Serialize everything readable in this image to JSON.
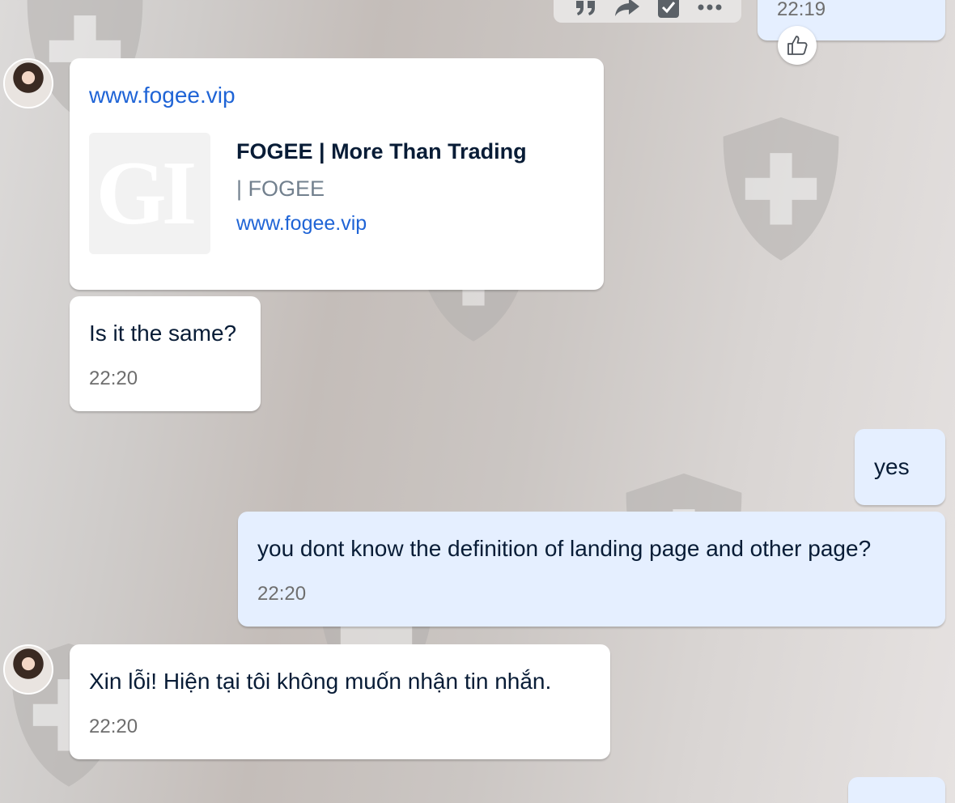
{
  "toolbar": {
    "icons": [
      "quote-icon",
      "forward-icon",
      "select-checkbox-icon",
      "more-icon"
    ]
  },
  "messages": [
    {
      "id": "m0",
      "sender": "me",
      "time": "22:19"
    },
    {
      "id": "m1",
      "sender": "other",
      "link_text": "www.fogee.vip",
      "preview": {
        "thumb_text": "GI",
        "title": "FOGEE | More Than Trading",
        "subtitle": "| FOGEE",
        "domain": "www.fogee.vip"
      }
    },
    {
      "id": "m2",
      "sender": "other",
      "text": "Is it the same?",
      "time": "22:20"
    },
    {
      "id": "m3",
      "sender": "me",
      "text": "yes"
    },
    {
      "id": "m4",
      "sender": "me",
      "text": "you dont know the definition of landing page and other page?",
      "time": "22:20"
    },
    {
      "id": "m5",
      "sender": "other",
      "text": "Xin lỗi! Hiện tại tôi không muốn nhận tin nhắn.",
      "time": "22:20"
    }
  ],
  "colors": {
    "other_bubble": "#ffffff",
    "my_bubble": "#e5efff",
    "link": "#1f64d6",
    "time": "#6e6e6e"
  }
}
